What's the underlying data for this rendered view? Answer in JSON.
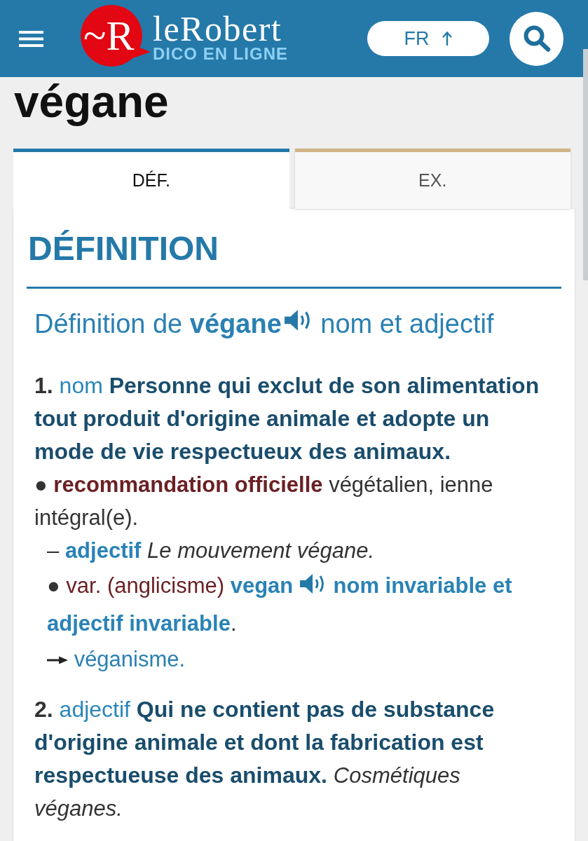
{
  "header": {
    "logo": {
      "mark": "~R",
      "name": "leRobert",
      "tagline": "DICO EN LIGNE"
    },
    "language_button": {
      "label": "FR"
    }
  },
  "headword": "végane",
  "tabs": [
    {
      "label": "DÉF.",
      "selected": true
    },
    {
      "label": "EX.",
      "selected": false
    }
  ],
  "section_title": "DÉFINITION",
  "entry_heading": {
    "prefix": "Définition de",
    "word": "végane",
    "category": "nom et adjectif"
  },
  "senses": [
    {
      "number": "1.",
      "category": "nom",
      "definition": "Personne qui exclut de son alimentation tout produit d'origine animale et adopte un mode de vie respectueux des animaux.",
      "notes": [
        {
          "kind": "recommendation",
          "marker": "●",
          "label": "recommandation officielle",
          "text": "végétalien, ienne intégral(e)."
        },
        {
          "kind": "usage",
          "marker": "–",
          "label": "adjectif",
          "example": "Le mouvement végane."
        },
        {
          "kind": "variant",
          "marker": "●",
          "label": "var. (anglicisme)",
          "word": "vegan",
          "categories": [
            "nom invariable",
            "adjectif invariable"
          ],
          "conjunction": "et",
          "end": "."
        },
        {
          "kind": "see_also",
          "link": "véganisme."
        }
      ]
    },
    {
      "number": "2.",
      "category": "adjectif",
      "definition": "Qui ne contient pas de substance d'origine animale et dont la fabrication est respectueuse des animaux.",
      "example": "Cosmétiques véganes."
    }
  ]
}
